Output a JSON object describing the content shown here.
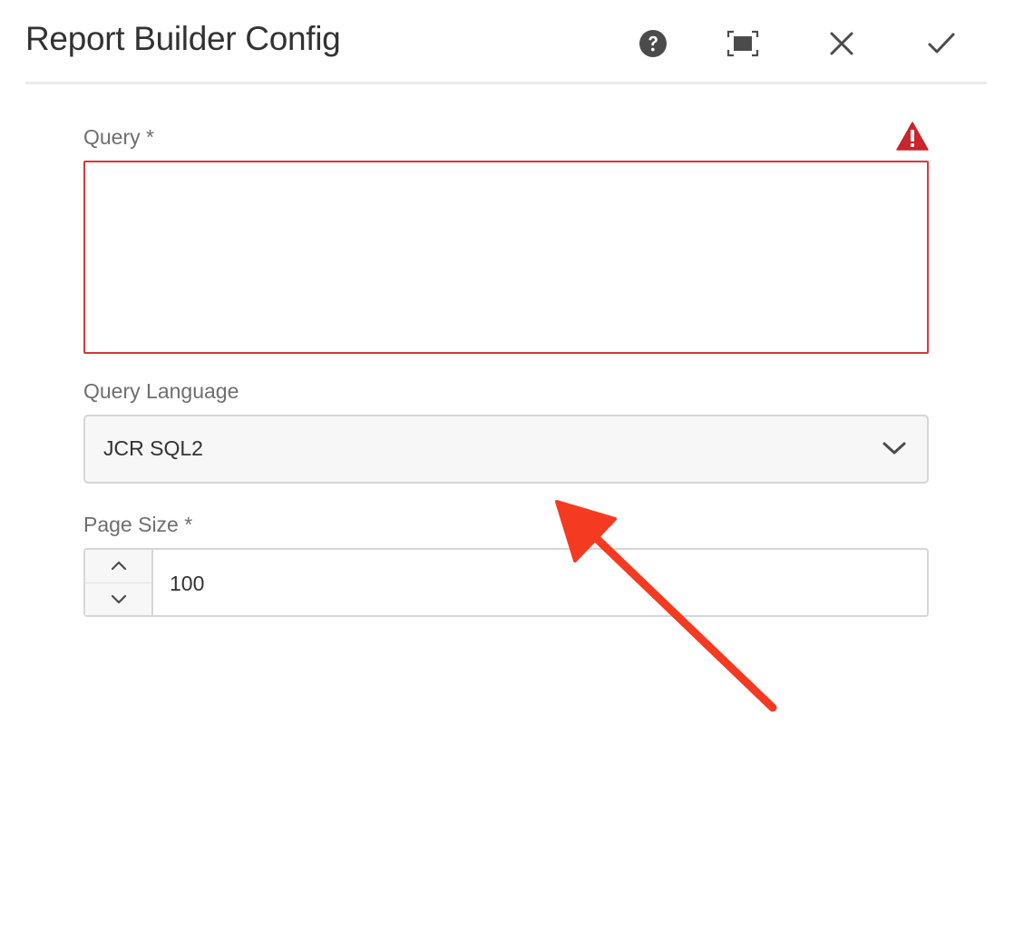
{
  "dialog": {
    "title": "Report Builder Config",
    "actions": {
      "help_icon": "help-icon",
      "fullscreen_icon": "fullscreen-icon",
      "close_icon": "close-icon",
      "done_icon": "checkmark-icon"
    }
  },
  "form": {
    "query": {
      "label": "Query *",
      "value": "",
      "invalid": true,
      "error_icon": "alert-icon"
    },
    "query_language": {
      "label": "Query Language",
      "selected": "JCR SQL2"
    },
    "page_size": {
      "label": "Page Size *",
      "value": "100"
    }
  },
  "annotation": {
    "type": "arrow",
    "color": "#f53a22"
  },
  "colors": {
    "error": "#d7373f",
    "text": "#323232",
    "label": "#6e6e6e",
    "icon": "#4b4b4b"
  }
}
